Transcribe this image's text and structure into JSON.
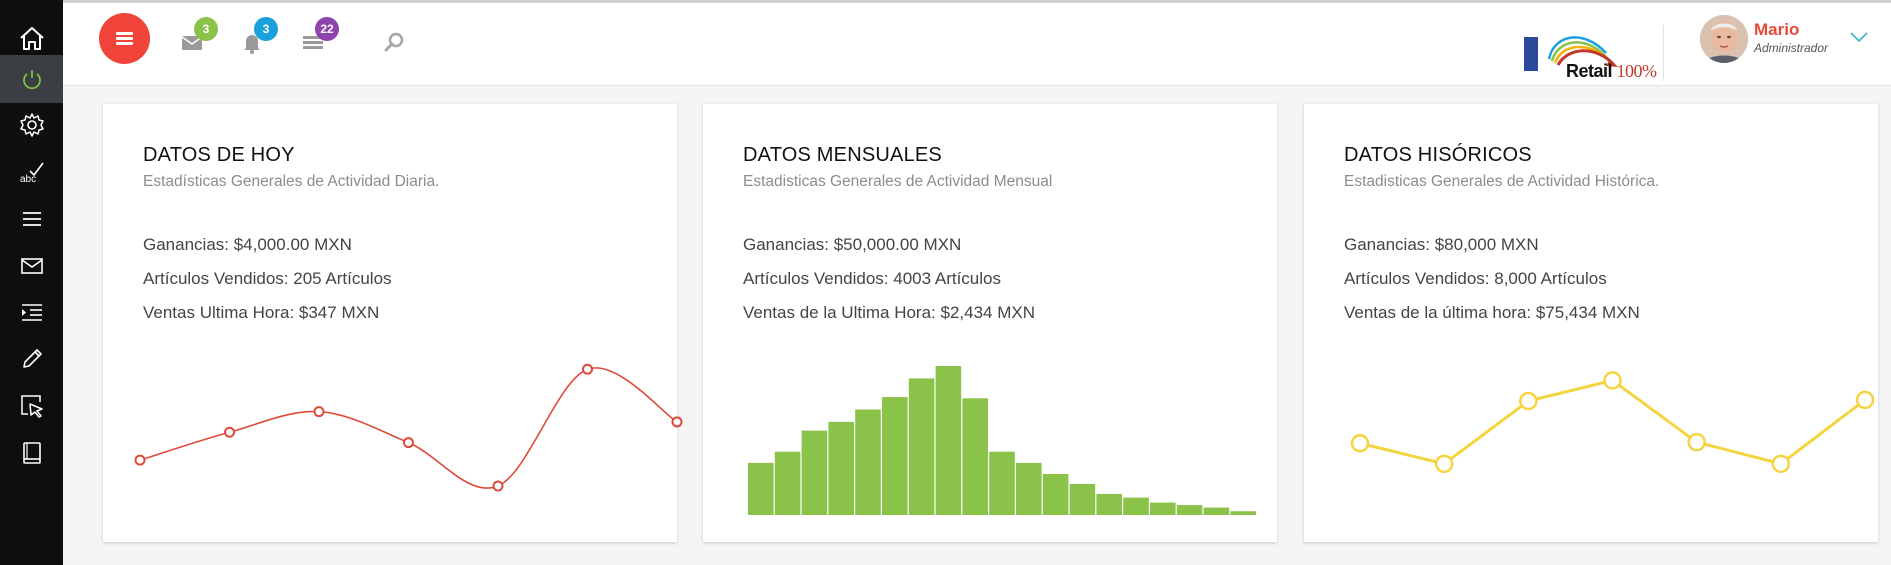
{
  "sidebar": {
    "items": [
      {
        "icon": "home-icon"
      },
      {
        "icon": "power-icon",
        "active": true
      },
      {
        "icon": "gear-icon"
      },
      {
        "icon": "spellcheck-icon"
      },
      {
        "icon": "menu-lines-icon"
      },
      {
        "icon": "mail-icon"
      },
      {
        "icon": "list-indent-icon"
      },
      {
        "icon": "pencil-icon"
      },
      {
        "icon": "cursor-select-icon"
      },
      {
        "icon": "book-icon"
      }
    ]
  },
  "topbar": {
    "messages_badge": "3",
    "notifications_badge": "3",
    "tasks_badge": "22",
    "logo_text": "Retail",
    "logo_percent": "100%",
    "user_name": "Mario",
    "user_role": "Administrador",
    "colors": {
      "menu": "#f0443a",
      "messages": "#8bc34a",
      "notifications": "#1aa0dc",
      "tasks": "#8e44ad"
    }
  },
  "cards": [
    {
      "title": "DATOS DE HOY",
      "subtitle": "Estadísticas Generales de Actividad Diaria.",
      "stats": [
        "Ganancias: $4,000.00 MXN",
        "Artículos Vendidos: 205 Artículos",
        "Ventas Ultima Hora: $347 MXN"
      ]
    },
    {
      "title": "DATOS MENSUALES",
      "subtitle": "Estadisticas Generales de Actividad Mensual",
      "stats": [
        "Ganancias: $50,000.00 MXN",
        "Artículos Vendidos: 4003 Artículos",
        "Ventas de la Ultima Hora: $2,434 MXN"
      ]
    },
    {
      "title": "DATOS HISÓRICOS",
      "subtitle": "Estadisticas Generales de Actividad Histórica.",
      "stats": [
        "Ganancias: $80,000 MXN",
        "Artículos Vendidos: 8,000 Artículos",
        "Ventas de la última hora: $75,434 MXN"
      ]
    }
  ],
  "chart_data": [
    {
      "type": "line",
      "smooth": true,
      "color": "#e04a3a",
      "values": [
        25,
        52,
        72,
        42,
        0,
        113,
        62
      ],
      "ylim": [
        0,
        120
      ]
    },
    {
      "type": "bar",
      "color": "#8bc34a",
      "values": [
        42,
        51,
        68,
        75,
        85,
        95,
        110,
        120,
        94,
        51,
        42,
        33,
        25,
        17,
        14,
        10,
        8,
        6,
        3
      ],
      "ylim": [
        0,
        120
      ]
    },
    {
      "type": "line",
      "smooth": false,
      "color": "#f5d442",
      "values": [
        45,
        26,
        84,
        103,
        46,
        26,
        85
      ],
      "ylim": [
        0,
        120
      ]
    }
  ]
}
